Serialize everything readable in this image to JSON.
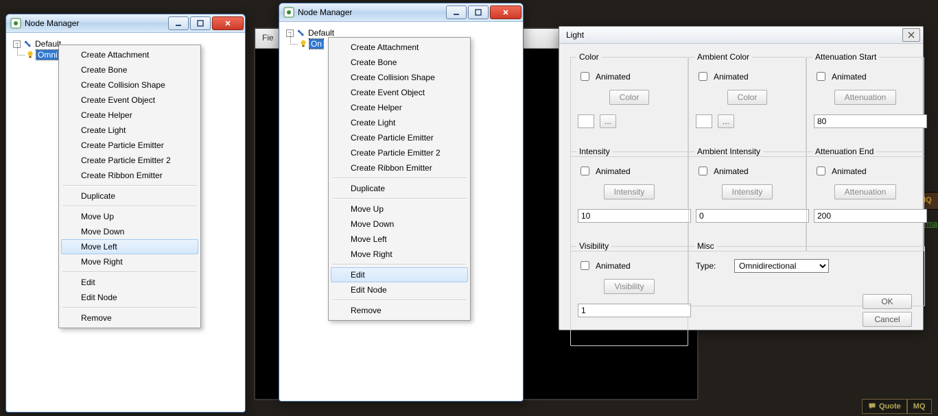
{
  "bg": {
    "tab_file": "Fie",
    "mq1": "IQ",
    "erma": "erma",
    "quote": "Quote",
    "mq2": "MQ"
  },
  "window1": {
    "title": "Node Manager",
    "tree": {
      "root": "Default",
      "selected": "Omni"
    },
    "menu": {
      "items": [
        "Create Attachment",
        "Create Bone",
        "Create Collision Shape",
        "Create Event Object",
        "Create Helper",
        "Create Light",
        "Create Particle Emitter",
        "Create Particle Emitter 2",
        "Create Ribbon Emitter"
      ],
      "dup": "Duplicate",
      "move": [
        "Move Up",
        "Move Down",
        "Move Left",
        "Move Right"
      ],
      "edit": [
        "Edit",
        "Edit Node"
      ],
      "remove": "Remove",
      "highlighted": "Move Left"
    }
  },
  "window2": {
    "title": "Node Manager",
    "tree": {
      "root": "Default",
      "selected": "On"
    },
    "menu": {
      "items": [
        "Create Attachment",
        "Create Bone",
        "Create Collision Shape",
        "Create Event Object",
        "Create Helper",
        "Create Light",
        "Create Particle Emitter",
        "Create Particle Emitter 2",
        "Create Ribbon Emitter"
      ],
      "dup": "Duplicate",
      "move": [
        "Move Up",
        "Move Down",
        "Move Left",
        "Move Right"
      ],
      "edit": [
        "Edit",
        "Edit Node"
      ],
      "remove": "Remove",
      "highlighted": "Edit"
    }
  },
  "light_dialog": {
    "title": "Light",
    "animated_label": "Animated",
    "color": {
      "legend": "Color",
      "button": "Color",
      "dots": "..."
    },
    "ambient_color": {
      "legend": "Ambient Color",
      "button": "Color",
      "dots": "..."
    },
    "att_start": {
      "legend": "Attenuation Start",
      "button": "Attenuation",
      "value": "80"
    },
    "intensity": {
      "legend": "Intensity",
      "button": "Intensity",
      "value": "10"
    },
    "ambient_intensity": {
      "legend": "Ambient Intensity",
      "button": "Intensity",
      "value": "0"
    },
    "att_end": {
      "legend": "Attenuation End",
      "button": "Attenuation",
      "value": "200"
    },
    "visibility": {
      "legend": "Visibility",
      "button": "Visibility",
      "value": "1"
    },
    "misc": {
      "legend": "Misc",
      "type_label": "Type:",
      "options": [
        "Omnidirectional"
      ],
      "selected": "Omnidirectional"
    },
    "ok": "OK",
    "cancel": "Cancel"
  }
}
